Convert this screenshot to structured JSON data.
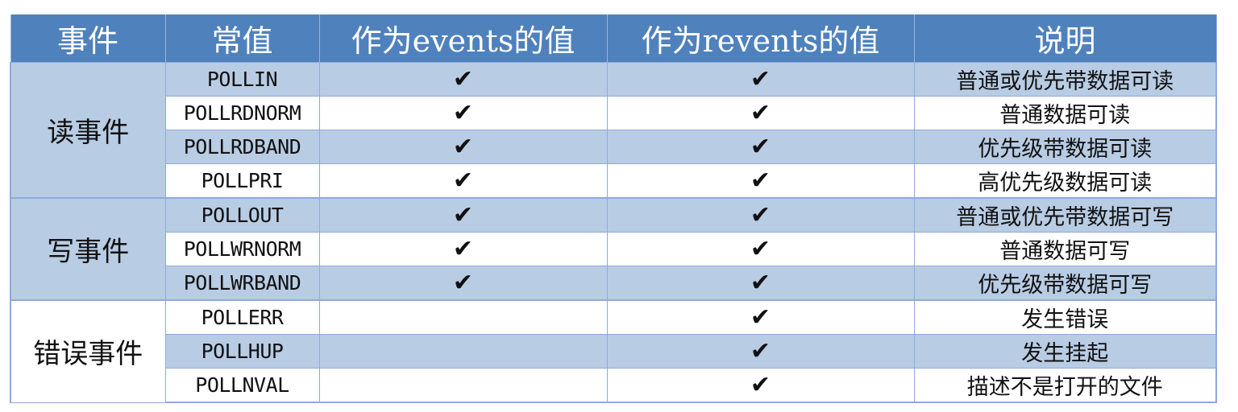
{
  "header": {
    "col_event": "事件",
    "col_const": "常值",
    "col_events": "作为events的值",
    "col_revents": "作为revents的值",
    "col_desc": "说明"
  },
  "groups": {
    "read": "读事件",
    "write": "写事件",
    "error": "错误事件"
  },
  "check_mark": "✔",
  "rows": [
    {
      "name": "POLLIN",
      "events": "✔",
      "revents": "✔",
      "desc": "普通或优先带数据可读"
    },
    {
      "name": "POLLRDNORM",
      "events": "✔",
      "revents": "✔",
      "desc": "普通数据可读"
    },
    {
      "name": "POLLRDBAND",
      "events": "✔",
      "revents": "✔",
      "desc": "优先级带数据可读"
    },
    {
      "name": "POLLPRI",
      "events": "✔",
      "revents": "✔",
      "desc": "高优先级数据可读"
    },
    {
      "name": "POLLOUT",
      "events": "✔",
      "revents": "✔",
      "desc": "普通或优先带数据可写"
    },
    {
      "name": "POLLWRNORM",
      "events": "✔",
      "revents": "✔",
      "desc": "普通数据可写"
    },
    {
      "name": "POLLWRBAND",
      "events": "✔",
      "revents": "✔",
      "desc": "优先级带数据可写"
    },
    {
      "name": "POLLERR",
      "events": "",
      "revents": "✔",
      "desc": "发生错误"
    },
    {
      "name": "POLLHUP",
      "events": "",
      "revents": "✔",
      "desc": "发生挂起"
    },
    {
      "name": "POLLNVAL",
      "events": "",
      "revents": "✔",
      "desc": "描述不是打开的文件"
    }
  ],
  "colors": {
    "header_bg": "#4f81bd",
    "band_bg": "#b8cce4",
    "border": "#8eaadb"
  }
}
